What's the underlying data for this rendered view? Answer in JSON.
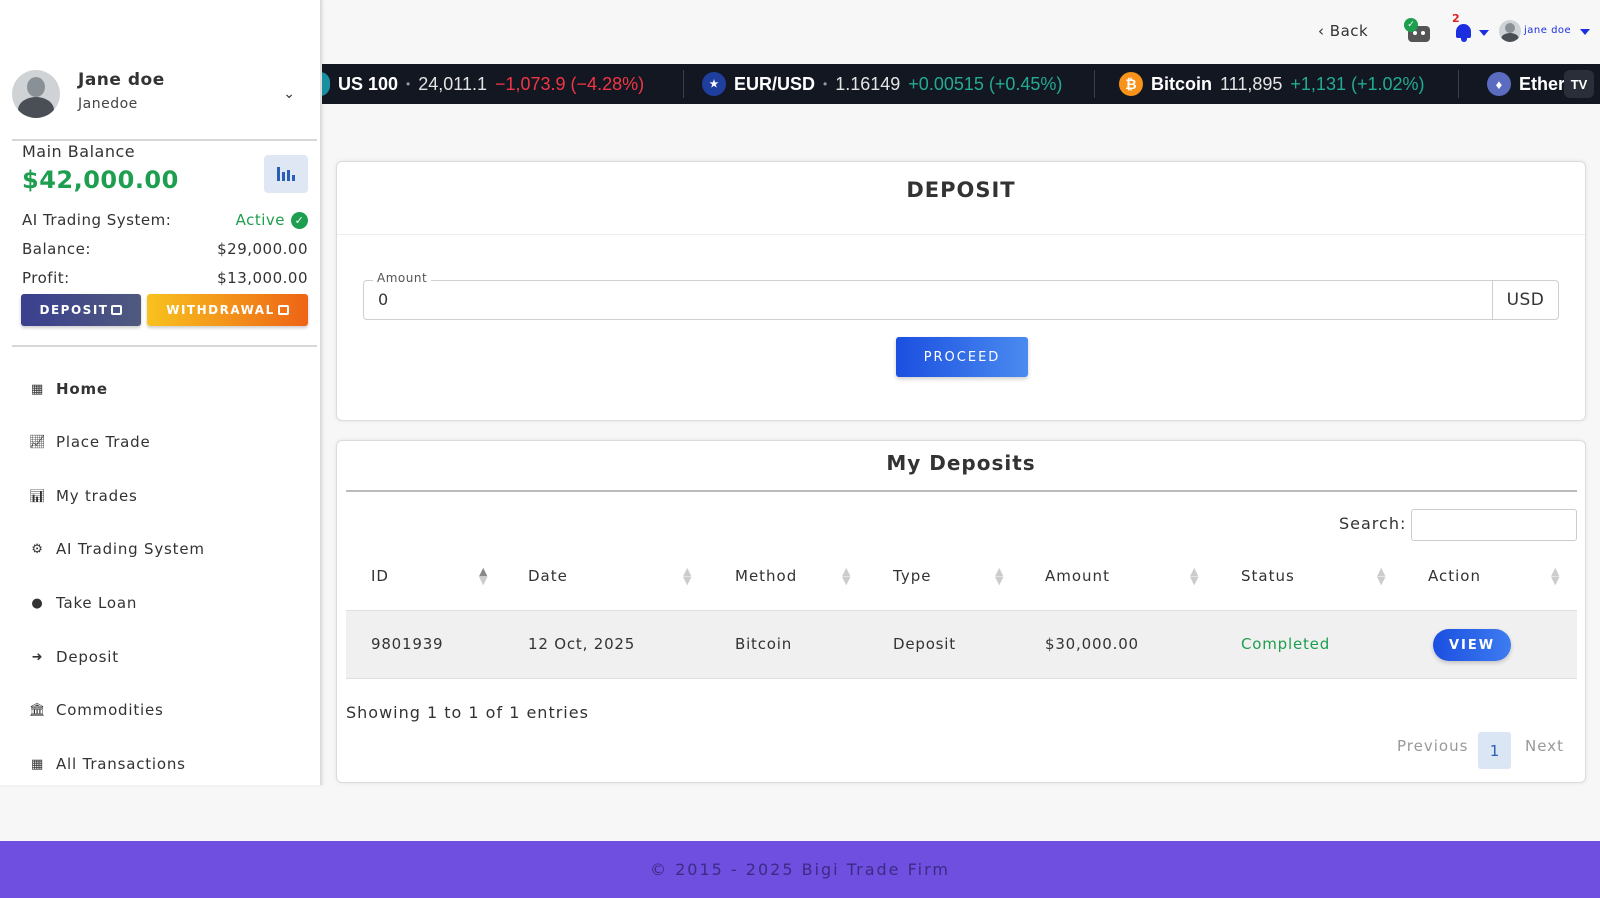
{
  "profile": {
    "name": "Jane doe",
    "username": "Janedoe"
  },
  "balance": {
    "title": "Main Balance",
    "amount": "$42,000.00",
    "ai_label": "AI Trading System:",
    "ai_status": "Active",
    "balance_label": "Balance:",
    "balance_value": "$29,000.00",
    "profit_label": "Profit:",
    "profit_value": "$13,000.00",
    "deposit_btn": "DEPOSIT",
    "withdrawal_btn": "WITHDRAWAL"
  },
  "nav": [
    {
      "label": "Home",
      "icon": "dashboard-icon"
    },
    {
      "label": "Place Trade",
      "icon": "line-chart-icon"
    },
    {
      "label": "My trades",
      "icon": "bar-chart-icon"
    },
    {
      "label": "AI Trading System",
      "icon": "robot-cogs-icon"
    },
    {
      "label": "Take Loan",
      "icon": "piggy-bank-icon"
    },
    {
      "label": "Deposit",
      "icon": "sign-in-icon"
    },
    {
      "label": "Commodities",
      "icon": "bank-icon"
    },
    {
      "label": "All Transactions",
      "icon": "calendar-icon"
    }
  ],
  "topbar": {
    "back": "Back",
    "notification_count": "2",
    "user": "jane doe"
  },
  "ticker": [
    {
      "symbol": "US 100",
      "price": "24,011.1",
      "change": "−1,073.9 (−4.28%)",
      "direction": "down"
    },
    {
      "symbol": "EUR/USD",
      "price": "1.16149",
      "change": "+0.00515 (+0.45%)",
      "direction": "up"
    },
    {
      "symbol": "Bitcoin",
      "price": "111,895",
      "change": "+1,131 (+1.02%)",
      "direction": "up"
    },
    {
      "symbol": "Ether",
      "price": "",
      "change": "",
      "direction": ""
    }
  ],
  "deposit_form": {
    "title": "DEPOSIT",
    "amount_label": "Amount",
    "amount_value": "0",
    "currency": "USD",
    "proceed": "PROCEED"
  },
  "my_deposits": {
    "title": "My Deposits",
    "search_label": "Search:",
    "columns": [
      "ID",
      "Date",
      "Method",
      "Type",
      "Amount",
      "Status",
      "Action"
    ],
    "rows": [
      {
        "id": "9801939",
        "date": "12 Oct, 2025",
        "method": "Bitcoin",
        "type": "Deposit",
        "amount": "$30,000.00",
        "status": "Completed",
        "action": "VIEW"
      }
    ],
    "showing": "Showing 1 to 1 of 1 entries",
    "pagination": {
      "previous": "Previous",
      "current": "1",
      "next": "Next"
    }
  },
  "footer": "© 2015 - 2025 Bigi Trade Firm",
  "colors": {
    "accent": "#1b4fe0",
    "success": "#1e9e4f",
    "footer": "#6e4fe0"
  }
}
